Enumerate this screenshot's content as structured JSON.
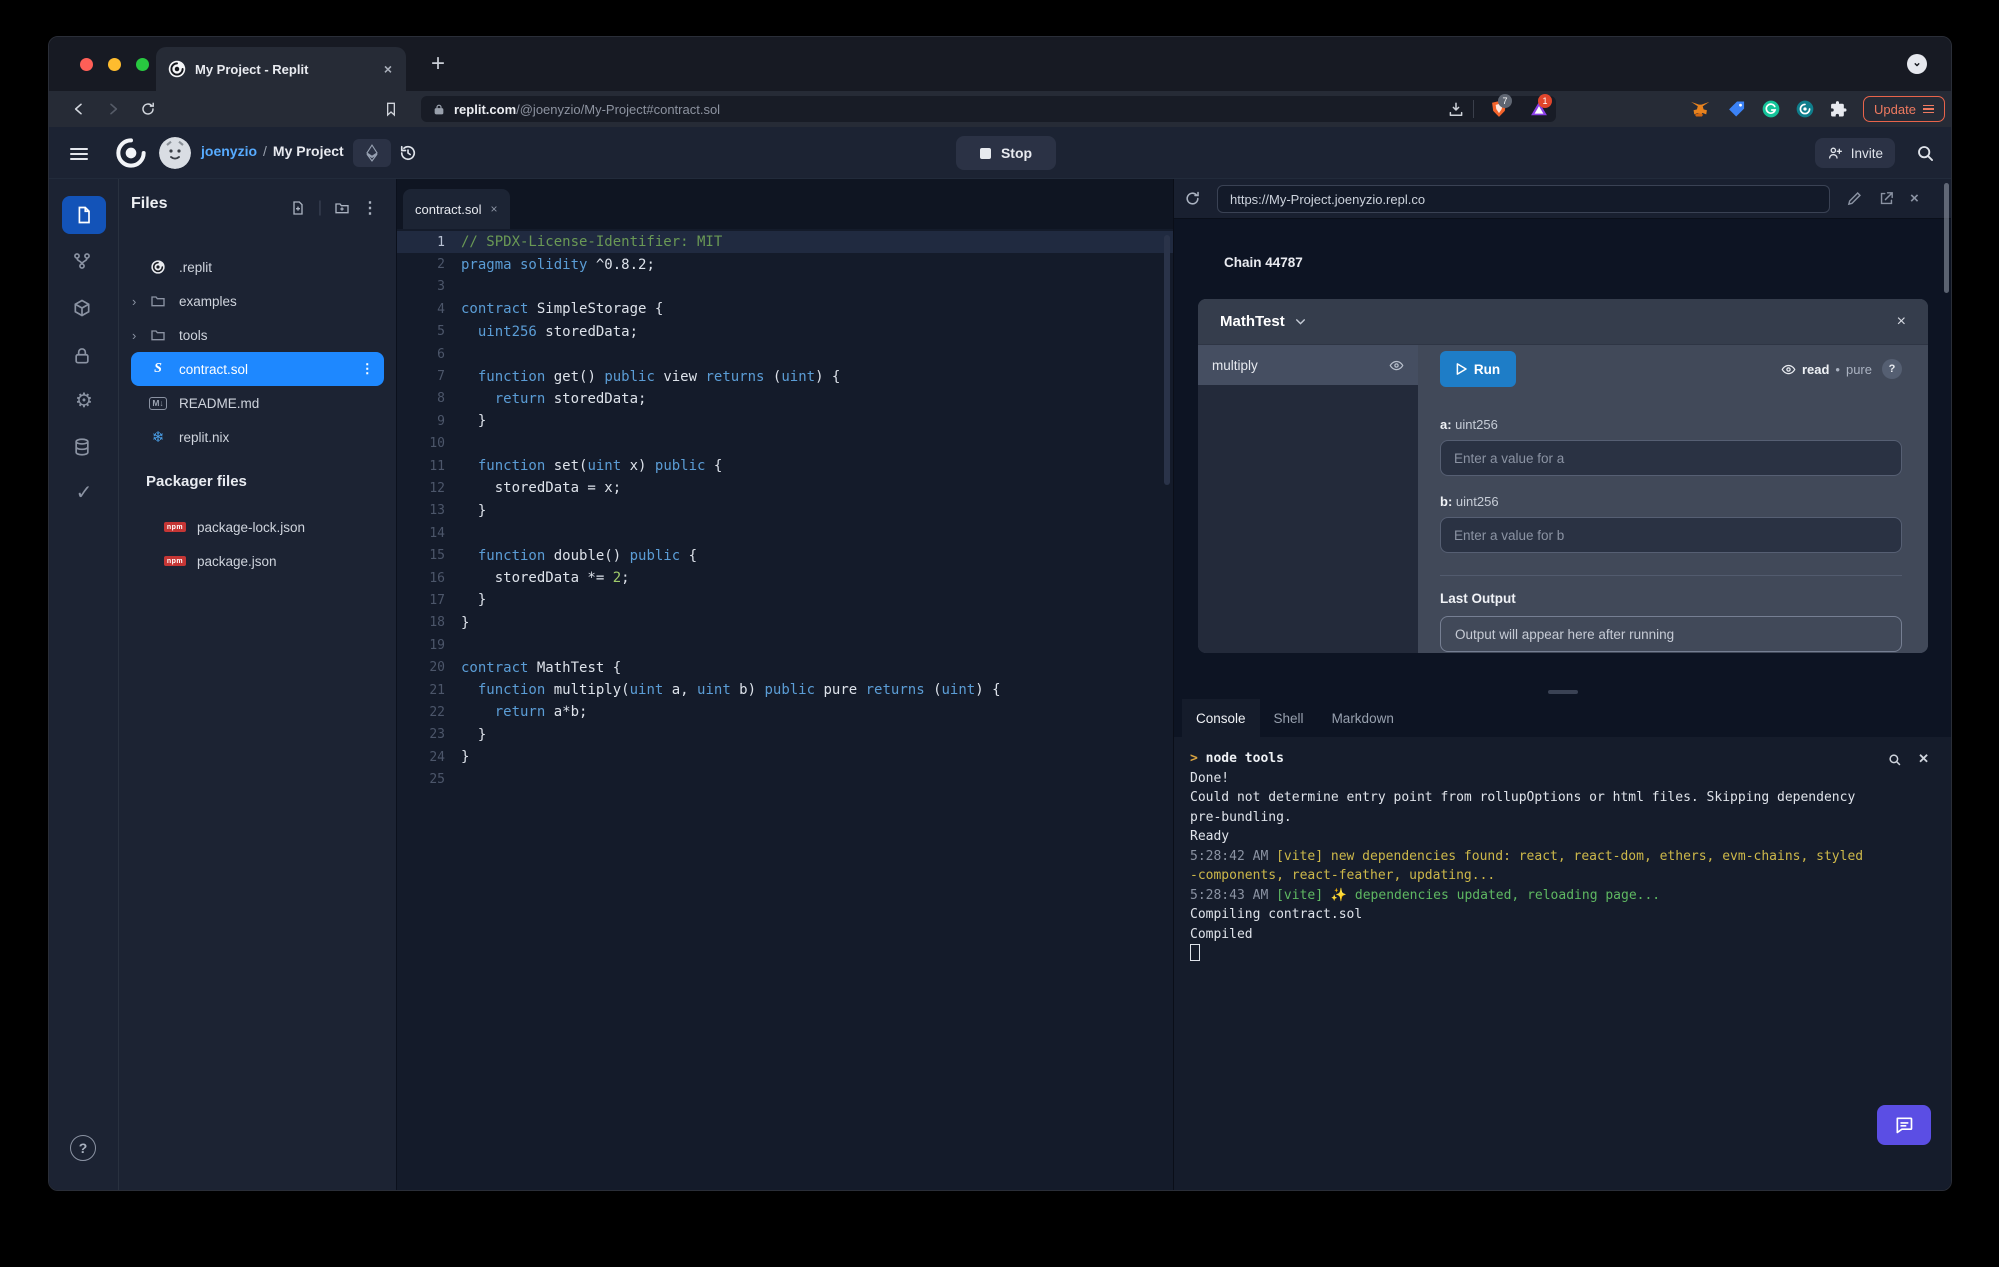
{
  "browser": {
    "tab_title": "My Project - Replit",
    "new_tab_label": "+",
    "close_tab_label": "×",
    "url_host": "replit.com",
    "url_path": "/@joenyzio/My-Project#contract.sol",
    "shield_badge": "7",
    "rewards_badge": "1",
    "update_label": "Update",
    "accent_update": "#e8644b"
  },
  "header": {
    "username": "joenyzio",
    "separator": "/",
    "project": "My Project",
    "stop_label": "Stop",
    "invite_label": "Invite"
  },
  "rail": {
    "items": [
      "files",
      "version-control",
      "packages",
      "secrets",
      "settings",
      "database",
      "checks"
    ],
    "help_label": "?"
  },
  "files": {
    "title": "Files",
    "kebab": "⋮",
    "items": [
      {
        "icon": "replit",
        "label": ".replit"
      },
      {
        "icon": "folder",
        "chevron": true,
        "label": "examples"
      },
      {
        "icon": "folder",
        "chevron": true,
        "label": "tools"
      },
      {
        "icon": "solidity",
        "label": "contract.sol",
        "selected": true
      },
      {
        "icon": "markdown",
        "label": "README.md"
      },
      {
        "icon": "nix",
        "label": "replit.nix"
      }
    ],
    "packager_title": "Packager files",
    "packager_items": [
      {
        "icon": "npm",
        "label": "package-lock.json"
      },
      {
        "icon": "npm",
        "label": "package.json"
      }
    ],
    "selected_color": "#1e88ff"
  },
  "editor": {
    "tab": "contract.sol",
    "tab_close": "×",
    "active_line": 1,
    "lines": [
      [
        [
          "c",
          "// SPDX-License-Identifier: MIT"
        ]
      ],
      [
        [
          "k",
          "pragma solidity"
        ],
        [
          "t",
          " ^0.8.2;"
        ]
      ],
      [],
      [
        [
          "k",
          "contract"
        ],
        [
          "t",
          " SimpleStorage {"
        ]
      ],
      [
        [
          "t",
          "  "
        ],
        [
          "k",
          "uint256"
        ],
        [
          "t",
          " storedData;"
        ]
      ],
      [],
      [
        [
          "t",
          "  "
        ],
        [
          "k",
          "function"
        ],
        [
          "t",
          " get() "
        ],
        [
          "k",
          "public"
        ],
        [
          "t",
          " view "
        ],
        [
          "k",
          "returns"
        ],
        [
          "t",
          " ("
        ],
        [
          "k",
          "uint"
        ],
        [
          "t",
          ") {"
        ]
      ],
      [
        [
          "t",
          "    "
        ],
        [
          "k",
          "return"
        ],
        [
          "t",
          " storedData;"
        ]
      ],
      [
        [
          "t",
          "  }"
        ]
      ],
      [],
      [
        [
          "t",
          "  "
        ],
        [
          "k",
          "function"
        ],
        [
          "t",
          " set("
        ],
        [
          "k",
          "uint"
        ],
        [
          "t",
          " x) "
        ],
        [
          "k",
          "public"
        ],
        [
          "t",
          " {"
        ]
      ],
      [
        [
          "t",
          "    storedData = x;"
        ]
      ],
      [
        [
          "t",
          "  }"
        ]
      ],
      [],
      [
        [
          "t",
          "  "
        ],
        [
          "k",
          "function"
        ],
        [
          "t",
          " double() "
        ],
        [
          "k",
          "public"
        ],
        [
          "t",
          " {"
        ]
      ],
      [
        [
          "t",
          "    storedData *= "
        ],
        [
          "n",
          "2"
        ],
        [
          "t",
          ";"
        ]
      ],
      [
        [
          "t",
          "  }"
        ]
      ],
      [
        [
          "t",
          "}"
        ]
      ],
      [],
      [
        [
          "k",
          "contract"
        ],
        [
          "t",
          " MathTest {"
        ]
      ],
      [
        [
          "t",
          "  "
        ],
        [
          "k",
          "function"
        ],
        [
          "t",
          " multiply("
        ],
        [
          "k",
          "uint"
        ],
        [
          "t",
          " a, "
        ],
        [
          "k",
          "uint"
        ],
        [
          "t",
          " b) "
        ],
        [
          "k",
          "public"
        ],
        [
          "t",
          " pure "
        ],
        [
          "k",
          "returns"
        ],
        [
          "t",
          " ("
        ],
        [
          "k",
          "uint"
        ],
        [
          "t",
          ") {"
        ]
      ],
      [
        [
          "t",
          "    "
        ],
        [
          "k",
          "return"
        ],
        [
          "t",
          " a*b;"
        ]
      ],
      [
        [
          "t",
          "  }"
        ]
      ],
      [
        [
          "t",
          "}"
        ]
      ],
      []
    ]
  },
  "webview": {
    "url": "https://My-Project.joenyzio.repl.co",
    "chain_label": "Chain 44787",
    "card": {
      "title": "MathTest",
      "close": "×",
      "function_name": "multiply",
      "run_label": "Run",
      "badge_read": "read",
      "badge_dot": "•",
      "badge_pure": "pure",
      "help": "?",
      "param_a_label": "a:",
      "param_a_type": " uint256",
      "param_a_placeholder": "Enter a value for a",
      "param_b_label": "b:",
      "param_b_type": " uint256",
      "param_b_placeholder": "Enter a value for b",
      "last_output_label": "Last Output",
      "last_output_placeholder": "Output will appear here after running",
      "run_color": "#1e7dc7"
    }
  },
  "console": {
    "tabs": [
      "Console",
      "Shell",
      "Markdown"
    ],
    "active_tab": "Console",
    "lines": [
      [
        [
          "p",
          "> "
        ],
        [
          "b",
          "node tools"
        ]
      ],
      [
        [
          "w",
          "Done!"
        ]
      ],
      [
        [
          "w",
          "Could not determine entry point from rollupOptions or html files. Skipping dependency"
        ]
      ],
      [
        [
          "w",
          "pre-bundling."
        ]
      ],
      [
        [
          "w",
          "Ready"
        ]
      ],
      [
        [
          "d",
          "5:28:42 AM "
        ],
        [
          "y",
          "[vite] new dependencies found: react, react-dom, ethers, evm-chains, styled"
        ]
      ],
      [
        [
          "y",
          "-components, react-feather, updating..."
        ]
      ],
      [
        [
          "d",
          "5:28:43 AM "
        ],
        [
          "g",
          "[vite] ✨ dependencies updated, reloading page..."
        ]
      ],
      [
        [
          "w",
          "Compiling contract.sol"
        ]
      ],
      [
        [
          "w",
          "Compiled"
        ]
      ],
      [
        [
          "cur",
          ""
        ]
      ]
    ]
  },
  "chat_fab_color": "#5b4ee4"
}
